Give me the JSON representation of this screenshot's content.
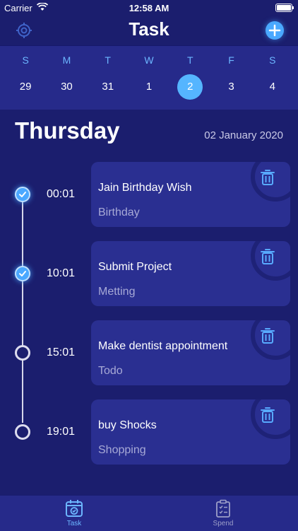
{
  "status_bar": {
    "carrier": "Carrier",
    "time": "12:58 AM"
  },
  "navbar": {
    "title": "Task",
    "left_icon": "target-icon",
    "right_icon": "plus-icon"
  },
  "calendar": {
    "weekdays": [
      "S",
      "M",
      "T",
      "W",
      "T",
      "F",
      "S"
    ],
    "dates": [
      "29",
      "30",
      "31",
      "1",
      "2",
      "3",
      "4"
    ],
    "selected_date": "2"
  },
  "header": {
    "day": "Thursday",
    "date": "02 January 2020"
  },
  "tasks": [
    {
      "time": "00:01",
      "title": "Jain Birthday Wish",
      "category": "Birthday",
      "done": true
    },
    {
      "time": "10:01",
      "title": "Submit Project",
      "category": "Metting",
      "done": true
    },
    {
      "time": "15:01",
      "title": "Make dentist appointment",
      "category": "Todo",
      "done": false
    },
    {
      "time": "19:01",
      "title": "buy Shocks",
      "category": "Shopping",
      "done": false
    }
  ],
  "tabbar": {
    "items": [
      {
        "label": "Task",
        "active": true
      },
      {
        "label": "Spend",
        "active": false
      }
    ]
  },
  "colors": {
    "background": "#1b1e6e",
    "card": "#2a2f91",
    "accent": "#4aa8ff",
    "muted": "#a7a9d6"
  }
}
